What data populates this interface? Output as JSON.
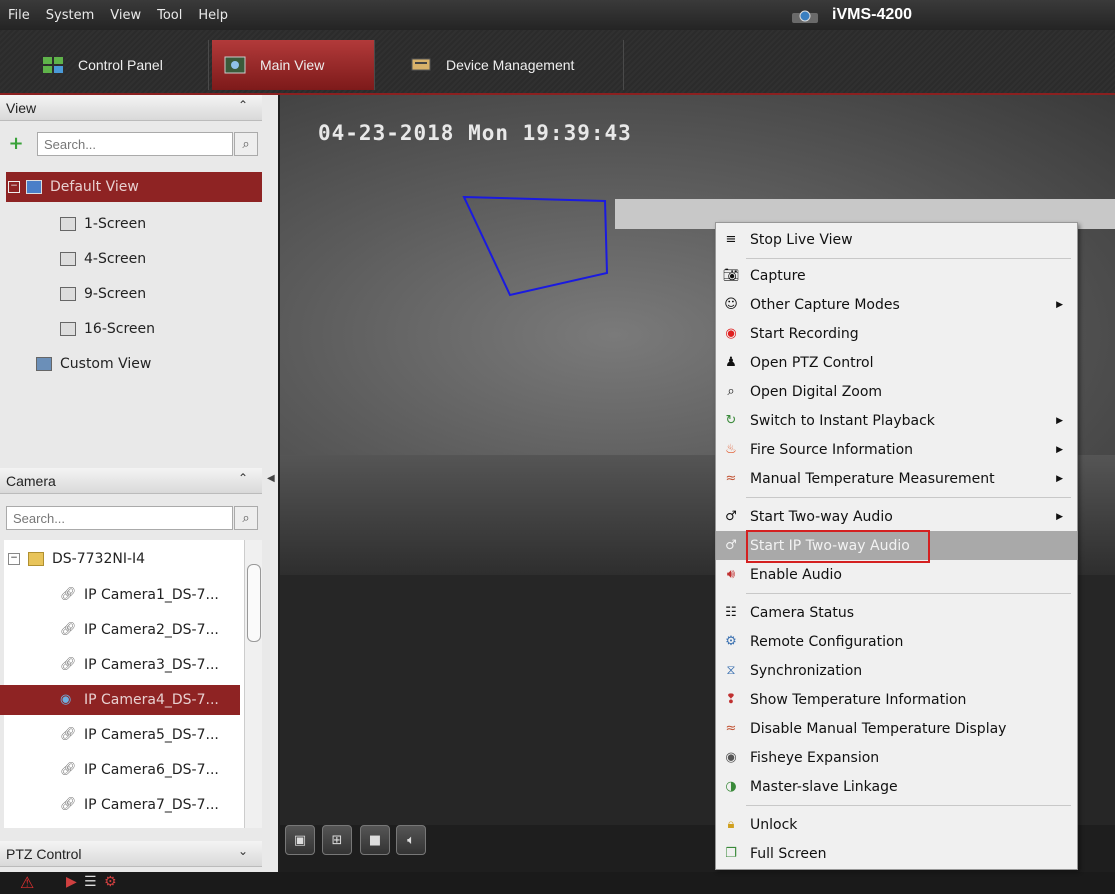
{
  "menubar": {
    "items": [
      "File",
      "System",
      "View",
      "Tool",
      "Help"
    ],
    "app_title": "iVMS-4200"
  },
  "tabs": [
    {
      "label": "Control Panel",
      "icon": "control-panel-icon"
    },
    {
      "label": "Main View",
      "icon": "main-view-icon",
      "active": true
    },
    {
      "label": "Device Management",
      "icon": "device-management-icon"
    }
  ],
  "view_panel": {
    "header": "View",
    "search_placeholder": "Search...",
    "tree": [
      {
        "label": "Default View",
        "selected": true
      },
      {
        "label": "1-Screen"
      },
      {
        "label": "4-Screen"
      },
      {
        "label": "9-Screen"
      },
      {
        "label": "16-Screen"
      },
      {
        "label": "Custom View"
      }
    ]
  },
  "camera_panel": {
    "header": "Camera",
    "search_placeholder": "Search...",
    "device": "DS-7732NI-I4",
    "cameras": [
      {
        "label": "IP Camera1_DS-7..."
      },
      {
        "label": "IP Camera2_DS-7..."
      },
      {
        "label": "IP Camera3_DS-7..."
      },
      {
        "label": "IP Camera4_DS-7...",
        "selected": true
      },
      {
        "label": "IP Camera5_DS-7..."
      },
      {
        "label": "IP Camera6_DS-7..."
      },
      {
        "label": "IP Camera7_DS-7..."
      }
    ]
  },
  "ptz_panel": {
    "header": "PTZ Control"
  },
  "video": {
    "osd_timestamp": "04-23-2018 Mon 19:39:43"
  },
  "context_menu": {
    "items": [
      {
        "label": "Stop Live View",
        "icon": "stop-icon"
      },
      {
        "label": "Capture",
        "icon": "camera-icon"
      },
      {
        "label": "Other Capture Modes",
        "icon": "capture-modes-icon",
        "submenu": true
      },
      {
        "label": "Start Recording",
        "icon": "record-icon"
      },
      {
        "label": "Open PTZ Control",
        "icon": "ptz-icon"
      },
      {
        "label": "Open Digital Zoom",
        "icon": "zoom-icon"
      },
      {
        "label": "Switch to Instant Playback",
        "icon": "playback-icon",
        "submenu": true
      },
      {
        "label": "Fire Source Information",
        "icon": "fire-icon",
        "submenu": true
      },
      {
        "label": "Manual Temperature Measurement",
        "icon": "temperature-chart-icon",
        "submenu": true
      },
      {
        "label": "Start Two-way Audio",
        "icon": "microphone-icon",
        "submenu": true
      },
      {
        "label": "Start IP Two-way Audio",
        "icon": "microphone-icon",
        "highlighted": true
      },
      {
        "label": "Enable Audio",
        "icon": "speaker-icon"
      },
      {
        "label": "Camera Status",
        "icon": "status-icon"
      },
      {
        "label": "Remote Configuration",
        "icon": "config-icon"
      },
      {
        "label": "Synchronization",
        "icon": "sync-icon"
      },
      {
        "label": "Show Temperature Information",
        "icon": "thermometer-icon"
      },
      {
        "label": "Disable Manual Temperature Display",
        "icon": "temperature-chart-icon"
      },
      {
        "label": "Fisheye Expansion",
        "icon": "fisheye-icon"
      },
      {
        "label": "Master-slave Linkage",
        "icon": "linkage-icon"
      },
      {
        "label": "Unlock",
        "icon": "lock-icon"
      },
      {
        "label": "Full Screen",
        "icon": "fullscreen-icon"
      }
    ]
  },
  "colors": {
    "accent": "#8e2323",
    "highlight_box": "#d42020",
    "detection_polygon": "#1a1ae0"
  }
}
